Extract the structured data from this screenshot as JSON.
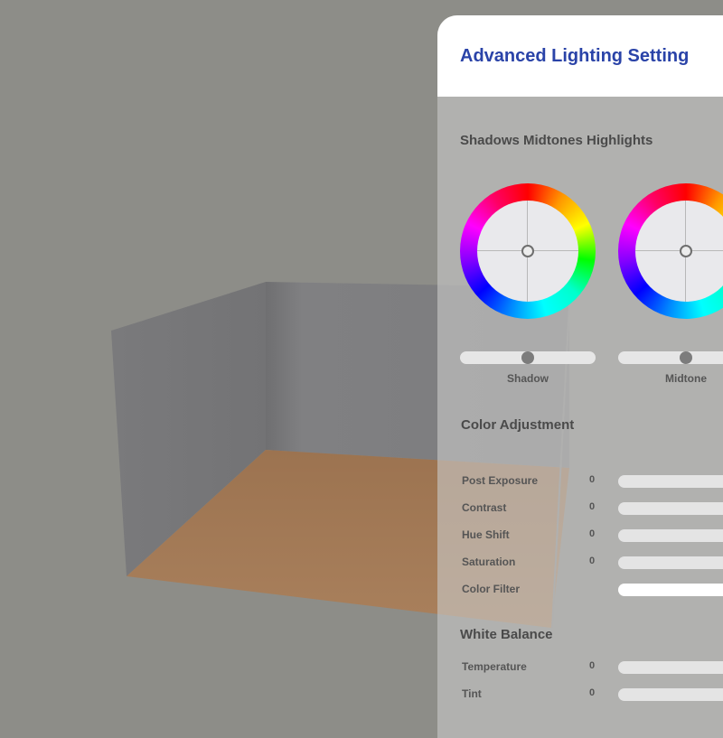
{
  "panel": {
    "title": "Advanced Lighting Setting"
  },
  "shadows_midtones_highlights": {
    "title": "Shadows Midtones Highlights",
    "wheels": [
      {
        "label": "Shadow",
        "slider_value": 0.5
      },
      {
        "label": "Midtone",
        "slider_value": 0.5
      }
    ]
  },
  "color_adjustment": {
    "title": "Color Adjustment",
    "rows": [
      {
        "label": "Post Exposure",
        "value": "0"
      },
      {
        "label": "Contrast",
        "value": "0"
      },
      {
        "label": "Hue Shift",
        "value": "0"
      },
      {
        "label": "Saturation",
        "value": "0"
      },
      {
        "label": "Color Filter",
        "value": ""
      }
    ]
  },
  "white_balance": {
    "title": "White Balance",
    "rows": [
      {
        "label": "Temperature",
        "value": "0"
      },
      {
        "label": "Tint",
        "value": "0"
      }
    ]
  },
  "colors": {
    "title": "#2a43a8",
    "floor": "#a57a55",
    "wall": "#7e7e80",
    "background": "#8d8d88"
  }
}
